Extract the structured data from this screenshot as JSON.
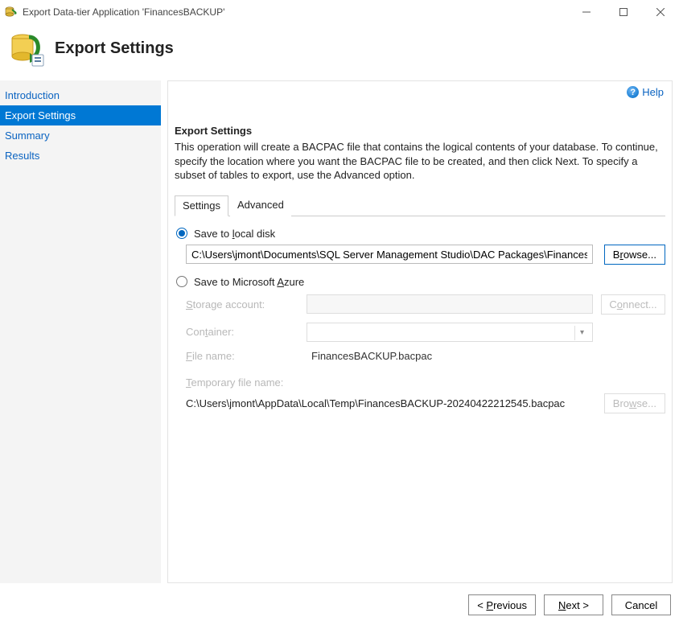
{
  "window": {
    "title": "Export Data-tier Application 'FinancesBACKUP'"
  },
  "header": {
    "title": "Export Settings"
  },
  "sidebar": {
    "items": [
      {
        "label": "Introduction",
        "role": "link"
      },
      {
        "label": "Export Settings",
        "role": "active"
      },
      {
        "label": "Summary",
        "role": "link"
      },
      {
        "label": "Results",
        "role": "link"
      }
    ]
  },
  "help": {
    "label": "Help"
  },
  "section": {
    "title": "Export Settings",
    "description": "This operation will create a BACPAC file that contains the logical contents of your database. To continue, specify the location where you want the BACPAC file to be created, and then click Next. To specify a subset of tables to export, use the Advanced option."
  },
  "tabs": {
    "items": [
      {
        "label": "Settings",
        "active": true
      },
      {
        "label": "Advanced",
        "active": false
      }
    ]
  },
  "options": {
    "local": {
      "label_pre": "Save to ",
      "und": "l",
      "label_post": "ocal disk",
      "checked": true,
      "path": "C:\\Users\\jmont\\Documents\\SQL Server Management Studio\\DAC Packages\\Finances.bacpac",
      "browse_pre": "B",
      "browse_und": "r",
      "browse_post": "owse..."
    },
    "azure": {
      "label_pre": "Save to Microsoft ",
      "und": "A",
      "label_post": "zure",
      "checked": false,
      "storage_label_und": "S",
      "storage_label_post": "torage account:",
      "connect_pre": "C",
      "connect_und": "o",
      "connect_post": "nnect...",
      "container_label_pre": "Con",
      "container_label_und": "t",
      "container_label_post": "ainer:",
      "filename_label_und": "F",
      "filename_label_post": "ile name:",
      "filename_value": "FinancesBACKUP.bacpac",
      "temp_label_und": "T",
      "temp_label_post": "emporary file name:",
      "temp_value": "C:\\Users\\jmont\\AppData\\Local\\Temp\\FinancesBACKUP-20240422212545.bacpac",
      "browse2_pre": "Bro",
      "browse2_und": "w",
      "browse2_post": "se..."
    }
  },
  "footer": {
    "previous_pre": "< ",
    "previous_und": "P",
    "previous_post": "revious",
    "next_und": "N",
    "next_post": "ext >",
    "cancel": "Cancel"
  }
}
